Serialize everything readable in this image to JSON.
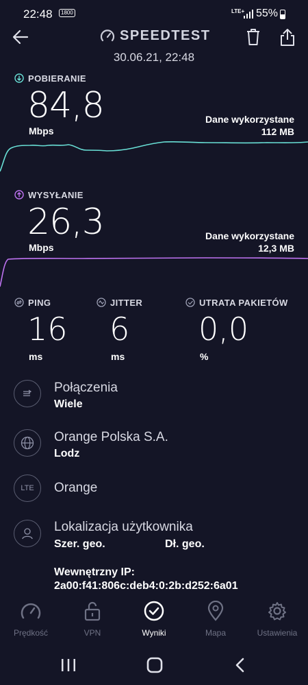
{
  "status_bar": {
    "time": "22:48",
    "network_badge": "1800",
    "lte": "LTE+",
    "battery": "55%"
  },
  "header": {
    "title": "SPEEDTEST",
    "date": "30.06.21, 22:48",
    "icons": [
      "back-arrow",
      "speedometer-logo",
      "trash",
      "share"
    ]
  },
  "download": {
    "label": "POBIERANIE",
    "value": "84,8",
    "unit": "Mbps",
    "data_used_label": "Dane wykorzystane",
    "data_used_value": "112 MB",
    "color": "#69e0d6"
  },
  "upload": {
    "label": "WYSYŁANIE",
    "value": "26,3",
    "unit": "Mbps",
    "data_used_label": "Dane wykorzystane",
    "data_used_value": "12,3 MB",
    "color": "#bf73f2"
  },
  "ping": {
    "label": "PING",
    "value": "16",
    "unit": "ms"
  },
  "jitter": {
    "label": "JITTER",
    "value": "6",
    "unit": "ms"
  },
  "packet_loss": {
    "label": "UTRATA PAKIETÓW",
    "value": "0,0",
    "unit": "%"
  },
  "details": [
    {
      "title": "Połączenia",
      "sub": "Wiele",
      "icon": "connections"
    },
    {
      "title": "Orange Polska S.A.",
      "sub": "Lodz",
      "icon": "globe"
    },
    {
      "title": "Orange",
      "sub": "",
      "icon": "lte",
      "icon_text": "LTE"
    },
    {
      "title": "Lokalizacja użytkownika",
      "sub_lat": "Szer. geo.",
      "sub_lon": "Dł. geo.",
      "icon": "user"
    }
  ],
  "internal_ip": {
    "label": "Wewnętrzny IP:",
    "value": "2a00:f41:806c:deb4:0:2b:d252:6a01"
  },
  "bottom_nav": [
    {
      "label": "Prędkość",
      "icon": "speedometer"
    },
    {
      "label": "VPN",
      "icon": "unlock"
    },
    {
      "label": "Wyniki",
      "icon": "check-circle",
      "active": true
    },
    {
      "label": "Mapa",
      "icon": "map-pin"
    },
    {
      "label": "Ustawienia",
      "icon": "gear"
    }
  ]
}
